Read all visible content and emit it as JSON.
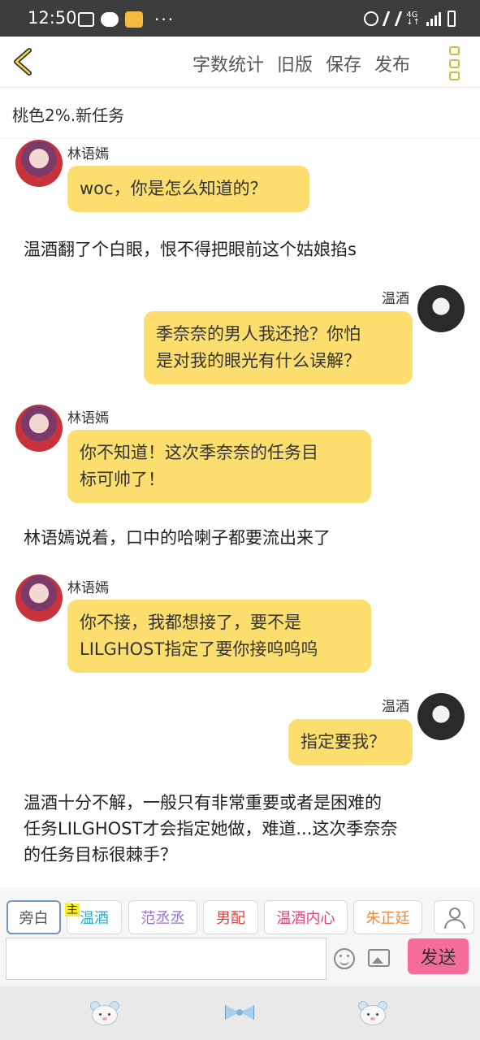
{
  "status_bar": {
    "time": "12:50",
    "network": "4G",
    "network_sub": "↓↑"
  },
  "toolbar": {
    "word_count": "字数统计",
    "old_version": "旧版",
    "save": "保存",
    "publish": "发布"
  },
  "story": {
    "title": "桃色2%.新任务"
  },
  "messages": [
    {
      "type": "chat",
      "side": "left",
      "speaker": "林语嫣",
      "text": "woc，你是怎么知道的？"
    },
    {
      "type": "narration",
      "text": "温酒翻了个白眼，恨不得把眼前这个姑娘掐s"
    },
    {
      "type": "chat",
      "side": "right",
      "speaker": "温酒",
      "lines": [
        "季奈奈的男人我还抢？你怕",
        "是对我的眼光有什么误解？"
      ]
    },
    {
      "type": "chat",
      "side": "left",
      "speaker": "林语嫣",
      "lines": [
        "你不知道！这次季奈奈的任务目",
        "标可帅了！"
      ]
    },
    {
      "type": "narration",
      "text": "林语嫣说着，口中的哈喇子都要流出来了"
    },
    {
      "type": "chat",
      "side": "left",
      "speaker": "林语嫣",
      "lines": [
        "你不接，我都想接了，要不是",
        "LILGHOST指定了要你接呜呜呜"
      ]
    },
    {
      "type": "chat",
      "side": "right",
      "speaker": "温酒",
      "text": "指定要我？"
    },
    {
      "type": "narration",
      "lines": [
        "温酒十分不解，一般只有非常重要或者是困难的",
        "任务LILGHOST才会指定她做，难道...这次季奈奈",
        "的任务目标很棘手？"
      ]
    }
  ],
  "role_tags": {
    "main_badge": "主",
    "items": [
      {
        "label": "旁白",
        "color": "#666666",
        "selected": true
      },
      {
        "label": "温酒",
        "color": "#2ab0c7"
      },
      {
        "label": "范丞丞",
        "color": "#9a6ed1"
      },
      {
        "label": "男配",
        "color": "#d8453f"
      },
      {
        "label": "温酒内心",
        "color": "#e0447a"
      },
      {
        "label": "朱正廷",
        "color": "#ee8a3e"
      }
    ]
  },
  "composer": {
    "input_value": "",
    "send": "发送"
  },
  "icons": {
    "back": "chevron-left-icon",
    "menu": "more-vertical-icon",
    "emoji": "emoji-icon",
    "image": "image-icon",
    "person": "person-icon",
    "nav_left": "bear-icon",
    "nav_center": "bow-icon",
    "nav_right": "bear-icon"
  },
  "colors": {
    "bubble": "#fcde6e",
    "send_button": "#f46c9a",
    "accent": "#d8b83c"
  }
}
